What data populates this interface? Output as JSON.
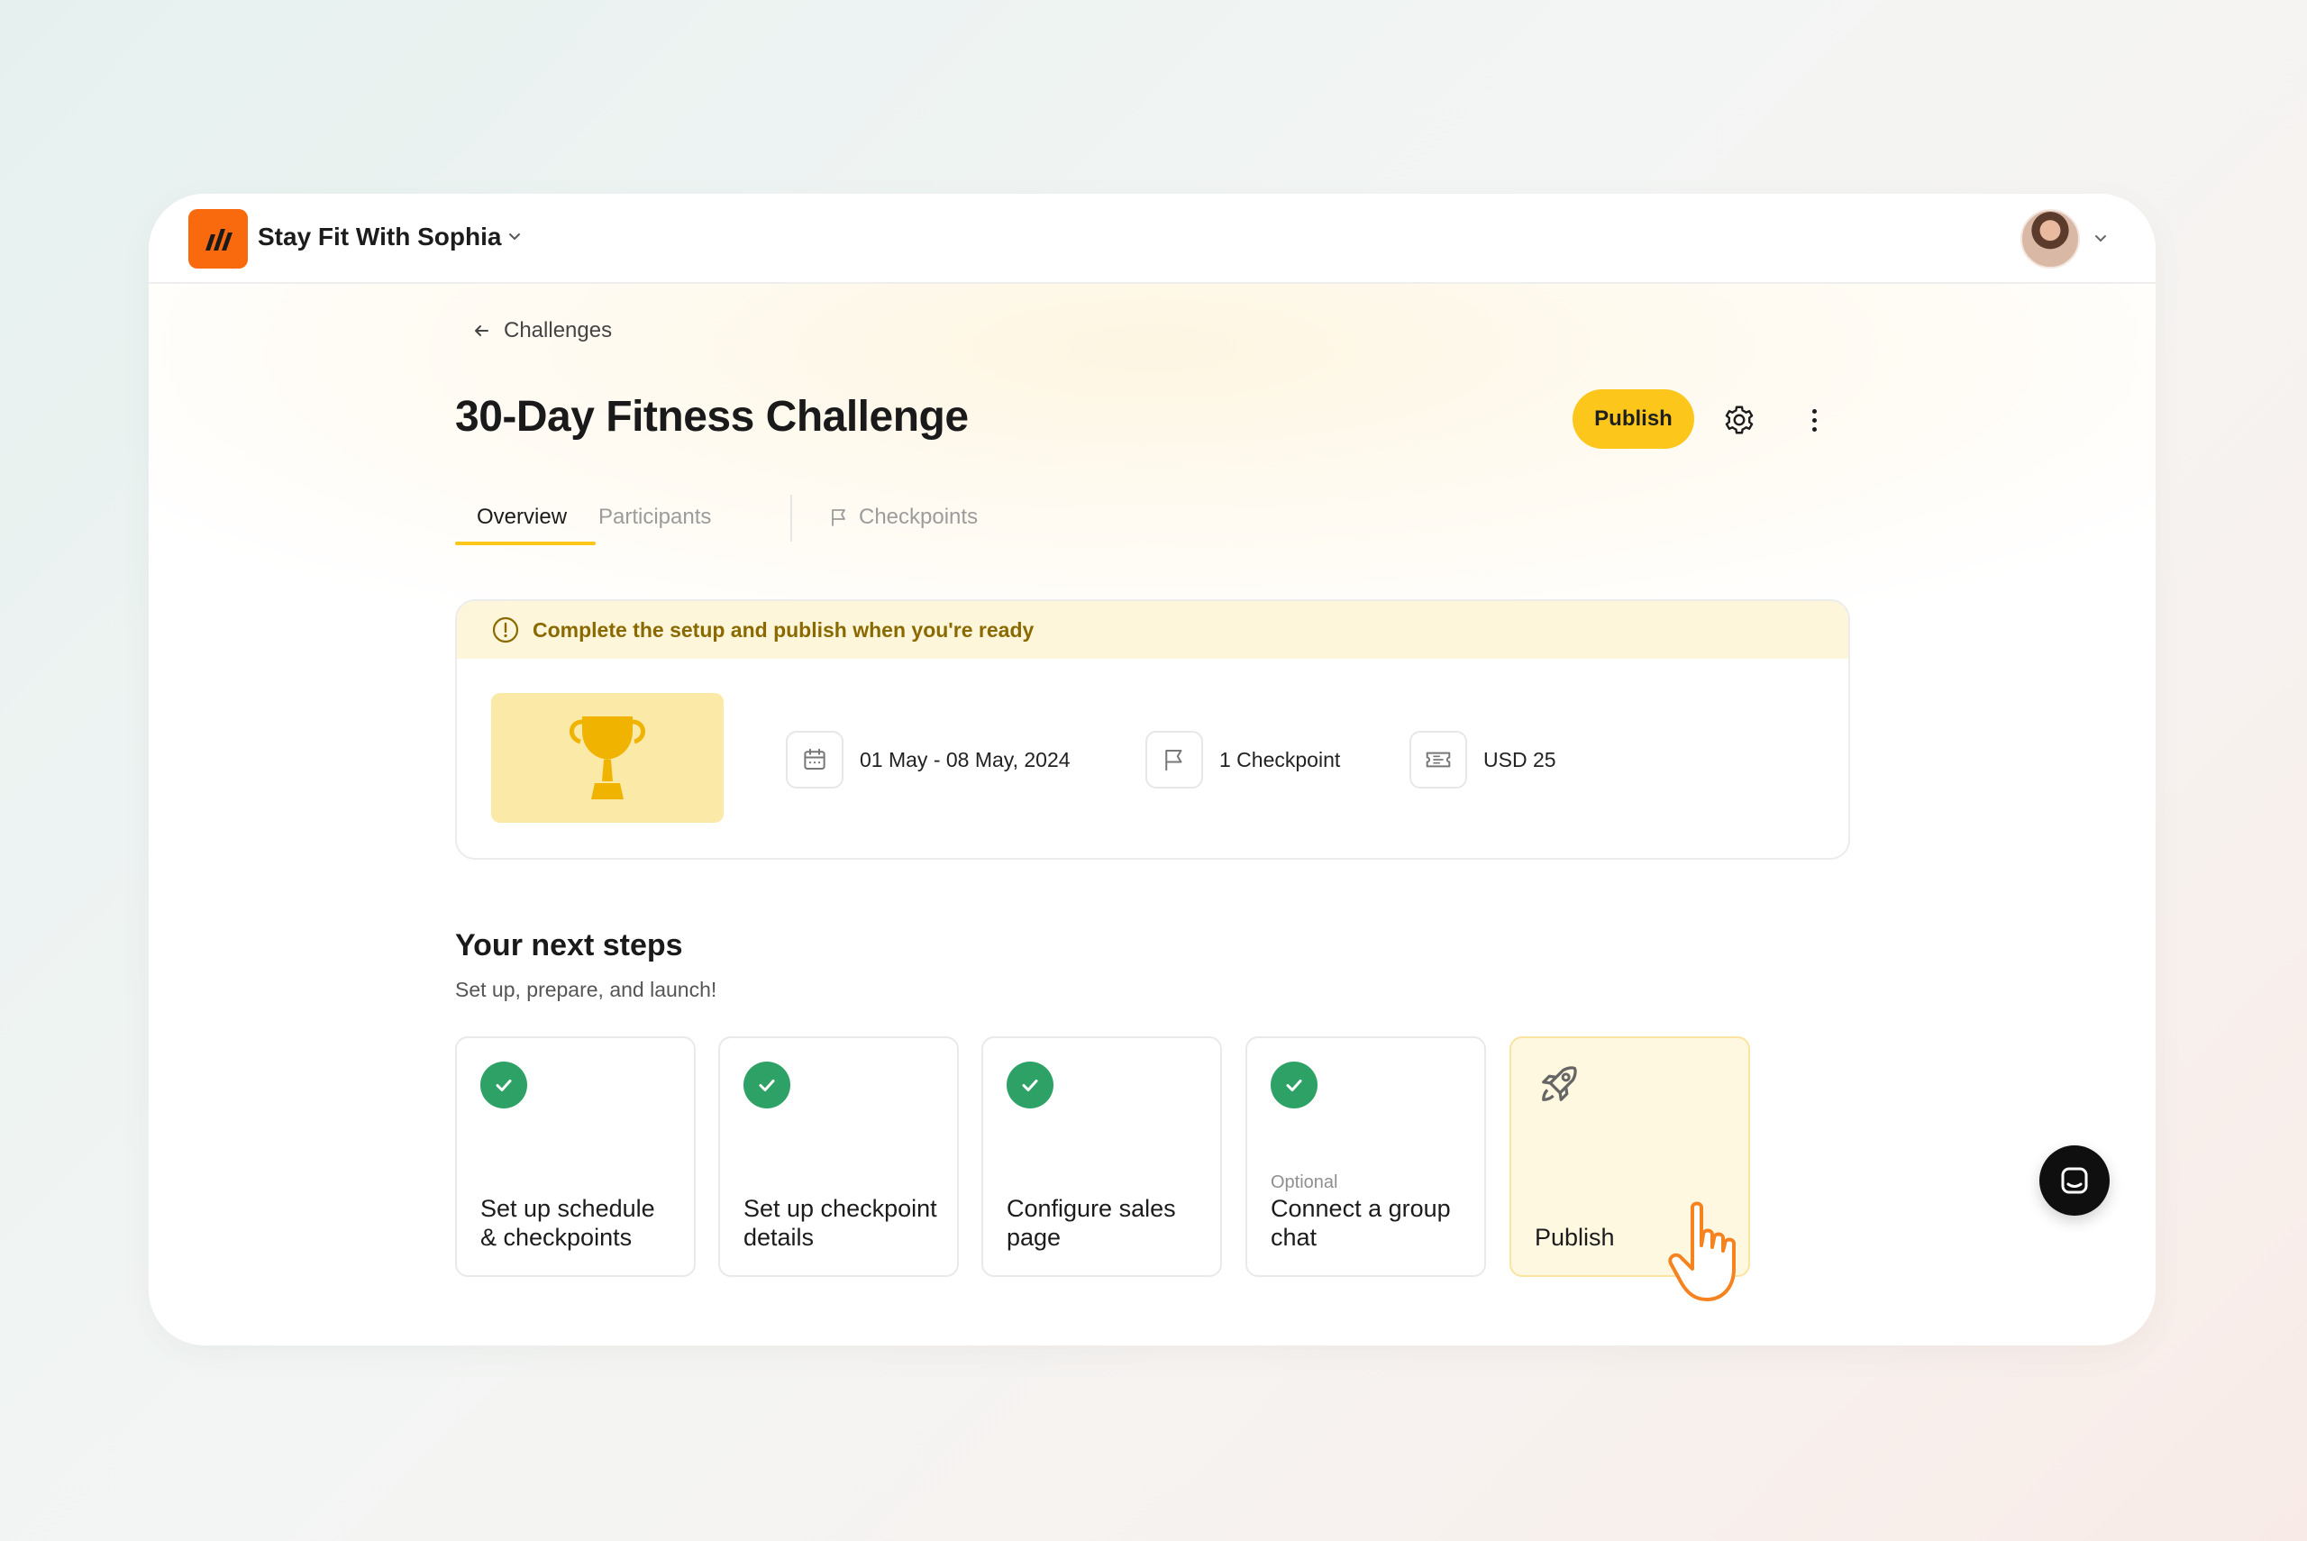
{
  "header": {
    "brand_name": "Stay Fit With Sophia",
    "brand_icon": "logo-mark",
    "brand_color": "#f96a0e"
  },
  "breadcrumb": {
    "back_label": "Challenges"
  },
  "page": {
    "title": "30-Day Fitness Challenge",
    "publish_label": "Publish",
    "accent_color": "#fcc61a"
  },
  "tabs": [
    {
      "label": "Overview",
      "active": true
    },
    {
      "label": "Participants",
      "active": false
    },
    {
      "label": "Checkpoints",
      "active": false,
      "icon": "flag-icon"
    }
  ],
  "info": {
    "banner_text": "Complete the setup and publish when you're ready",
    "dates": "01 May - 08 May, 2024",
    "checkpoints": "1 Checkpoint",
    "price": "USD 25"
  },
  "next_steps": {
    "title": "Your next steps",
    "subtitle": "Set up, prepare, and launch!",
    "items": [
      {
        "label": "Set up schedule & checkpoints",
        "done": true
      },
      {
        "label": "Set up checkpoint details",
        "done": true
      },
      {
        "label": "Configure sales page",
        "done": true
      },
      {
        "label": "Connect a group chat",
        "tag": "Optional",
        "done": true
      },
      {
        "label": "Publish",
        "done": false,
        "icon": "rocket-icon"
      }
    ]
  },
  "colors": {
    "success": "#2ea266",
    "warning_text": "#8a6a00",
    "warning_bg": "#fdf6db"
  }
}
